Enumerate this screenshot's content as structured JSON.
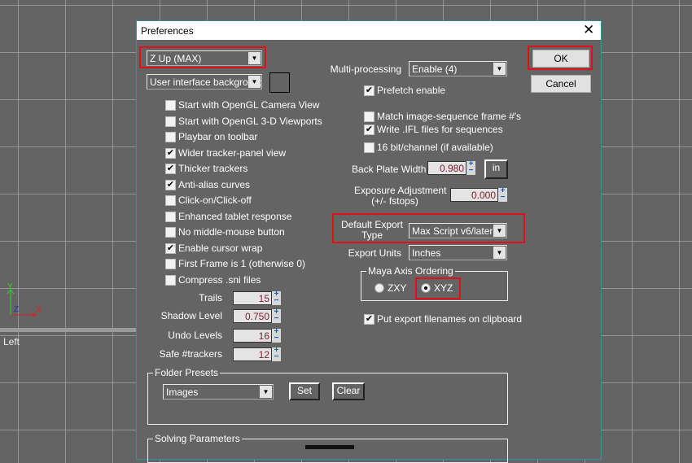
{
  "viewport": {
    "label": "Left",
    "axes": {
      "y": "Y",
      "x": "X",
      "z": "Z"
    }
  },
  "dialog": {
    "title": "Preferences",
    "close": "✕",
    "axis_dropdown": "Z Up (MAX)",
    "bg_dropdown": "User interface background",
    "checkboxes": [
      {
        "label": "Start with OpenGL Camera View",
        "checked": false
      },
      {
        "label": "Start with OpenGL 3-D Viewports",
        "checked": false
      },
      {
        "label": "Playbar on toolbar",
        "checked": false
      },
      {
        "label": "Wider tracker-panel view",
        "checked": true
      },
      {
        "label": "Thicker trackers",
        "checked": true
      },
      {
        "label": "Anti-alias curves",
        "checked": true
      },
      {
        "label": "Click-on/Click-off",
        "checked": false
      },
      {
        "label": "Enhanced tablet response",
        "checked": false
      },
      {
        "label": "No middle-mouse button",
        "checked": false
      },
      {
        "label": "Enable cursor wrap",
        "checked": true
      },
      {
        "label": "First Frame is 1 (otherwise 0)",
        "checked": false
      },
      {
        "label": "Compress .sni files",
        "checked": false
      }
    ],
    "spinners": [
      {
        "label": "Trails",
        "value": "15"
      },
      {
        "label": "Shadow Level",
        "value": "0.750"
      },
      {
        "label": "Undo Levels",
        "value": "16"
      },
      {
        "label": "Safe #trackers",
        "value": "12"
      }
    ],
    "folder_presets": {
      "title": "Folder Presets",
      "dropdown": "Images",
      "set": "Set",
      "clear": "Clear"
    },
    "solving_parameters": {
      "title": "Solving Parameters"
    },
    "multiprocessing": {
      "label": "Multi-processing",
      "value": "Enable (4)"
    },
    "right_checks": [
      {
        "label": "Prefetch enable",
        "checked": true
      },
      {
        "label": "Match image-sequence frame #'s",
        "checked": false
      },
      {
        "label": "Write .IFL files for sequences",
        "checked": true
      },
      {
        "label": "16 bit/channel (if available)",
        "checked": false
      },
      {
        "label": "Put export filenames on clipboard",
        "checked": true
      }
    ],
    "back_plate": {
      "label": "Back Plate Width",
      "value": "0.980",
      "unit": "in"
    },
    "exposure": {
      "label1": "Exposure Adjustment",
      "label2": "(+/- fstops)",
      "value": "0.000"
    },
    "export_type": {
      "label1": "Default Export",
      "label2": "Type",
      "value": "Max Script v6/later"
    },
    "export_units": {
      "label": "Export Units",
      "value": "Inches"
    },
    "maya_axis": {
      "title": "Maya Axis Ordering",
      "options": [
        "ZXY",
        "XYZ"
      ],
      "selected": "XYZ"
    },
    "ok": "OK",
    "cancel": "Cancel",
    "highlight_color": "#e0101a"
  }
}
